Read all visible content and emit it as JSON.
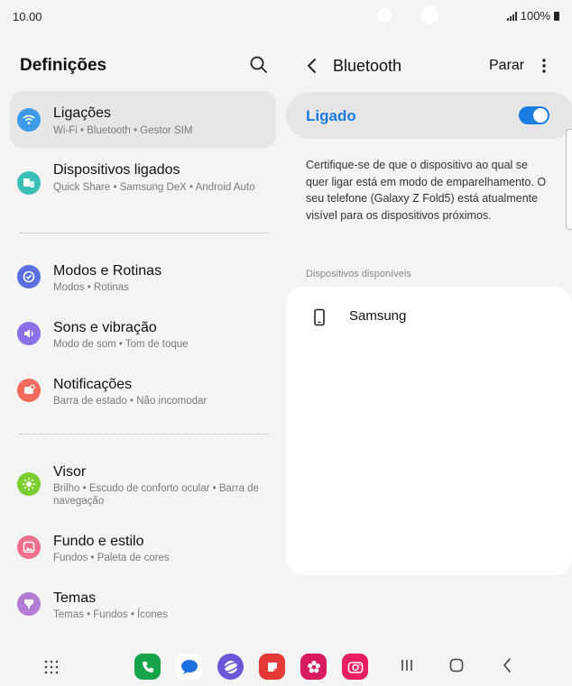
{
  "status_bar": {
    "time": "10.00",
    "battery": "100%"
  },
  "left_pane": {
    "title": "Definições",
    "items": [
      {
        "title": "Ligações",
        "subtitle": "Wi-Fi  •  Bluetooth  •  Gestor SIM",
        "icon": "wifi-icon",
        "color": "#3d9be9"
      },
      {
        "title": "Dispositivos ligados",
        "subtitle": "Quick Share  •  Samsung DeX  •  Android Auto",
        "icon": "connected-devices-icon",
        "color": "#3bbfb7"
      },
      {
        "title": "Modos e Rotinas",
        "subtitle": "Modos  •  Rotinas",
        "icon": "modes-icon",
        "color": "#5a6fe0"
      },
      {
        "title": "Sons e vibração",
        "subtitle": "Modo de som  •  Tom de toque",
        "icon": "sound-icon",
        "color": "#8a6fe6"
      },
      {
        "title": "Notificações",
        "subtitle": "Barra de estado  •  Não incomodar",
        "icon": "notifications-icon",
        "color": "#f26b5b"
      },
      {
        "title": "Visor",
        "subtitle": "Brilho  •  Escudo de conforto ocular  •  Barra de navegação",
        "icon": "display-icon",
        "color": "#7ccd2f"
      },
      {
        "title": "Fundo e estilo",
        "subtitle": "Fundos  •  Paleta de cores",
        "icon": "wallpaper-icon",
        "color": "#ef6e8e"
      },
      {
        "title": "Temas",
        "subtitle": "Temas  •  Fundos  •  Ícones",
        "icon": "themes-icon",
        "color": "#b37ad6"
      }
    ]
  },
  "right_pane": {
    "title": "Bluetooth",
    "stop_label": "Parar",
    "toggle_label": "Ligado",
    "toggle_on": true,
    "description": "Certifique-se de que o dispositivo ao qual se quer ligar está em modo de emparelhamento. O seu telefone (Galaxy Z Fold5) está atualmente visível para os dispositivos próximos.",
    "section_label": "Dispositivos disponíveis",
    "devices": [
      {
        "name": "Samsung",
        "icon": "phone-icon"
      }
    ]
  },
  "taskbar": {
    "apps": [
      {
        "name": "phone-app-icon",
        "color": "#16a34a"
      },
      {
        "name": "messages-app-icon",
        "color": "#ffffff"
      },
      {
        "name": "internet-app-icon",
        "color": "#6b57d6"
      },
      {
        "name": "notes-app-icon",
        "color": "#e53935"
      },
      {
        "name": "gallery-app-icon",
        "color": "#d81b60"
      },
      {
        "name": "camera-app-icon",
        "color": "#e91e63"
      }
    ]
  }
}
